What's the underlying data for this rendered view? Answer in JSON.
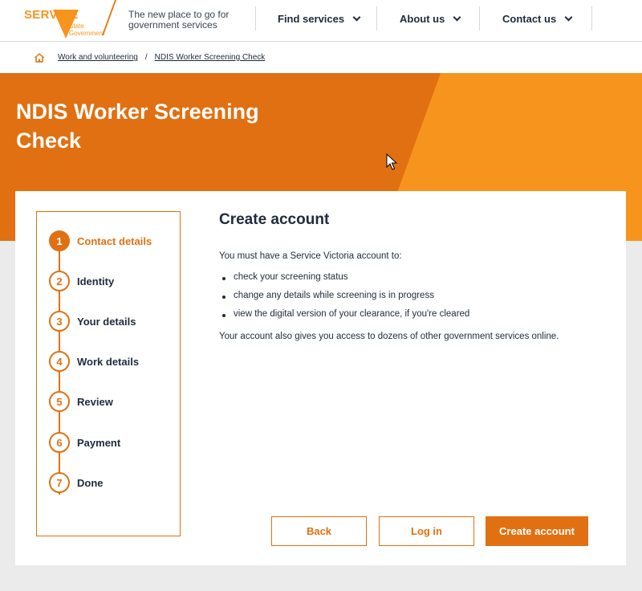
{
  "header": {
    "logo_word": "SERVICE",
    "logo_sub": "State Government",
    "tagline": "The new place to go for government services",
    "nav": [
      {
        "label": "Find services"
      },
      {
        "label": "About us"
      },
      {
        "label": "Contact us"
      }
    ]
  },
  "breadcrumb": {
    "items": [
      "Work and volunteering",
      "NDIS Worker Screening Check"
    ],
    "separator": "/"
  },
  "hero": {
    "title": "NDIS Worker Screening Check"
  },
  "stepper": {
    "steps": [
      {
        "number": "1",
        "label": "Contact details",
        "active": true
      },
      {
        "number": "2",
        "label": "Identity"
      },
      {
        "number": "3",
        "label": "Your details"
      },
      {
        "number": "4",
        "label": "Work details"
      },
      {
        "number": "5",
        "label": "Review"
      },
      {
        "number": "6",
        "label": "Payment"
      },
      {
        "number": "7",
        "label": "Done"
      }
    ]
  },
  "content": {
    "heading": "Create account",
    "intro": "You must have a Service Victoria account to:",
    "bullets": [
      "check your screening status",
      "change any details while screening is in progress",
      "view the digital version of your clearance, if you're cleared"
    ],
    "outro": "Your account also gives you access to dozens of other government services online."
  },
  "actions": {
    "back": "Back",
    "login": "Log in",
    "create": "Create account"
  },
  "colors": {
    "primary": "#e07011",
    "accent": "#f7941d",
    "text": "#1f2a3c"
  }
}
